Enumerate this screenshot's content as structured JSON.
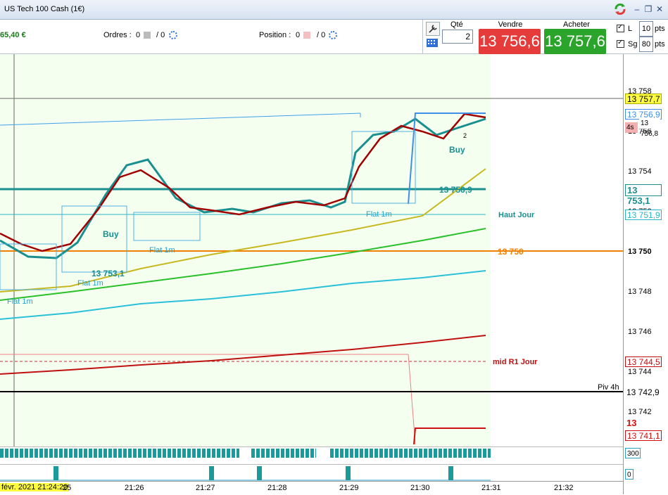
{
  "window": {
    "title": "US Tech 100 Cash (1€)"
  },
  "toolbar": {
    "balance": "65,40 €",
    "orders_label": "Ordres :",
    "orders_value_a": "0",
    "orders_value_b": "/ 0",
    "position_label": "Position :",
    "position_value_a": "0",
    "position_value_b": "/ 0",
    "qty_label": "Qté",
    "qty_value": "2",
    "sell_label": "Vendre",
    "sell_price": "13 756,6",
    "buy_label": "Acheter",
    "buy_price": "13 757,6",
    "l_label": "L",
    "l_value": "10",
    "sg_label": "Sg",
    "sg_value": "80",
    "pts_label": "pts",
    "pts_label2": "pts"
  },
  "colors": {
    "sell": "#e53b3b",
    "buy": "#2aa42a",
    "teal": "#1a8f8f",
    "orange": "#f08000",
    "darkred": "#b40000"
  },
  "y_axis": {
    "ticks": [
      "13 758",
      "13 756",
      "13 754",
      "13 752",
      "13 750",
      "13 748",
      "13 746",
      "13 744",
      "13 742"
    ],
    "tags": {
      "price_top": "13 757,7",
      "price_blue": "13 756,9",
      "price_small": "13 756,8",
      "countdown": "4s",
      "teal_line": "13 753,1",
      "haut_jour": "13 751,9",
      "level_750": "13 750",
      "mid_r1": "13 744,5",
      "piv4h": "13 742,9",
      "red_level": "13 741,1",
      "red_level2": "13 741,1",
      "vol_axis": "300",
      "ind_axis": "0"
    }
  },
  "labels": {
    "buy1": "Buy",
    "buy2": "Buy",
    "flat1": "Flat 1m",
    "flat2": "Flat 1m",
    "flat3": "Flat 1m",
    "flat4": "Flat 1m",
    "price_label_1": "13 753,1",
    "price_label_2": "13 756,9",
    "haut_jour": "Haut Jour",
    "orange_label": "13 750",
    "mid_r1": "mid R1 Jour",
    "piv4h": "Piv 4h",
    "marker_2": "2"
  },
  "x_axis": {
    "ticks": [
      "févr. 2021 21:24:20",
      "25",
      "21:26",
      "21:27",
      "21:28",
      "21:29",
      "21:30",
      "21:31",
      "21:32"
    ]
  },
  "chart_data": {
    "type": "line",
    "x": [
      "21:25",
      "21:26",
      "21:27",
      "21:28",
      "21:29",
      "21:30",
      "21:31",
      "21:32"
    ],
    "ylim": [
      13740,
      13759
    ],
    "series": []
  }
}
